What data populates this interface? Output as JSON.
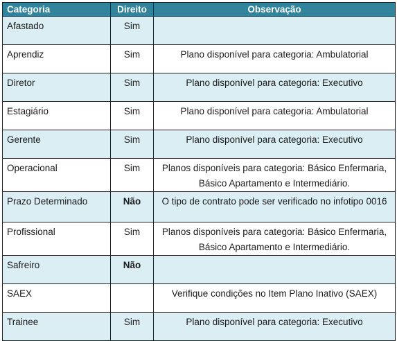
{
  "headers": {
    "categoria": "Categoria",
    "direito": "Direito",
    "observacao": "Observação"
  },
  "rows": [
    {
      "categoria": "Afastado",
      "direito": "Sim",
      "observacao": "",
      "bold": false
    },
    {
      "categoria": "Aprendiz",
      "direito": "Sim",
      "observacao": "Plano disponível para categoria: Ambulatorial",
      "bold": false
    },
    {
      "categoria": "Diretor",
      "direito": "Sim",
      "observacao": "Plano disponível para categoria: Executivo",
      "bold": false
    },
    {
      "categoria": "Estagiário",
      "direito": "Sim",
      "observacao": "Plano disponível para categoria: Ambulatorial",
      "bold": false
    },
    {
      "categoria": "Gerente",
      "direito": "Sim",
      "observacao": "Plano disponível para categoria: Executivo",
      "bold": false
    },
    {
      "categoria": "Operacional",
      "direito": "Sim",
      "observacao": "Planos disponíveis para categoria: Básico Enfermaria, Básico Apartamento e Intermediário.",
      "bold": false
    },
    {
      "categoria": "Prazo Determinado",
      "direito": "Não",
      "observacao": "O tipo de contrato pode ser verificado no infotipo 0016",
      "bold": true
    },
    {
      "categoria": "Profissional",
      "direito": "Sim",
      "observacao": "Planos disponíveis para categoria: Básico Enfermaria, Básico Apartamento e Intermediário.",
      "bold": false
    },
    {
      "categoria": "Safreiro",
      "direito": "Não",
      "observacao": "",
      "bold": true
    },
    {
      "categoria": "SAEX",
      "direito": "",
      "observacao": "Verifique condições no Item Plano Inativo (SAEX)",
      "bold": false
    },
    {
      "categoria": "Trainee",
      "direito": "Sim",
      "observacao": "Plano disponível para categoria: Executivo",
      "bold": false
    }
  ],
  "colors": {
    "header_bg": "#31849b",
    "row_alt_bg": "#daeef3",
    "border": "#1f1f1f"
  }
}
